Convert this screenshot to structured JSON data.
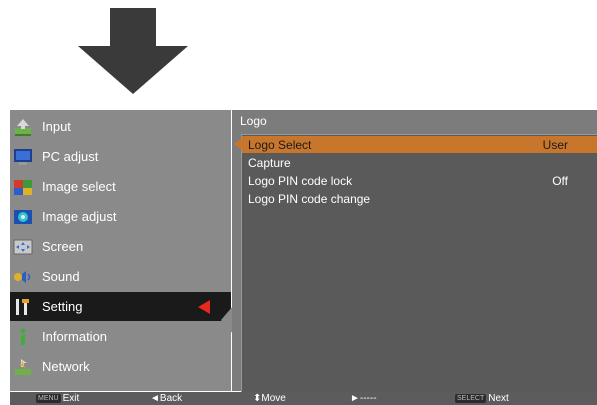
{
  "menu": {
    "items": [
      {
        "label": "Input",
        "icon": "input-icon"
      },
      {
        "label": "PC adjust",
        "icon": "pc-adjust-icon"
      },
      {
        "label": "Image select",
        "icon": "image-select-icon"
      },
      {
        "label": "Image adjust",
        "icon": "image-adjust-icon"
      },
      {
        "label": "Screen",
        "icon": "screen-icon"
      },
      {
        "label": "Sound",
        "icon": "sound-icon"
      },
      {
        "label": "Setting",
        "icon": "setting-icon",
        "selected": true
      },
      {
        "label": "Information",
        "icon": "information-icon"
      },
      {
        "label": "Network",
        "icon": "network-icon"
      }
    ]
  },
  "submenu": {
    "title": "Logo",
    "items": [
      {
        "label": "Logo Select",
        "value": "User",
        "highlighted": true
      },
      {
        "label": "Capture",
        "value": ""
      },
      {
        "label": "Logo PIN code lock",
        "value": "Off"
      },
      {
        "label": "Logo PIN code change",
        "value": ""
      }
    ]
  },
  "bottom_bar": {
    "exit_key": "MENU",
    "exit_label": "Exit",
    "back_label": "◄Back",
    "move_label": "⬍Move",
    "forward_label": "►-----",
    "next_key": "SELECT",
    "next_label": "Next"
  },
  "colors": {
    "menu_panel": "#8a8a8a",
    "selected_item": "#1a1a1a",
    "pointer": "#e8281c",
    "highlight": "#c8762c",
    "arrow": "#3a3a3a"
  }
}
